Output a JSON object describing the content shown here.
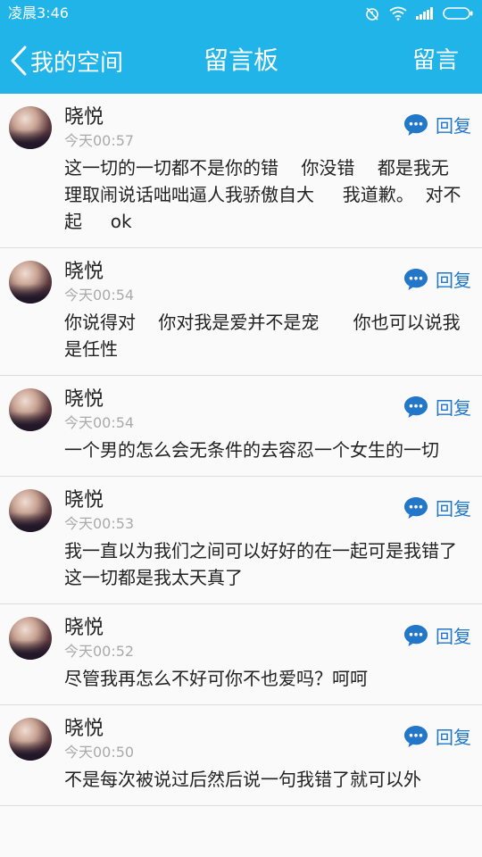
{
  "status_bar": {
    "time": "凌晨3:46"
  },
  "nav": {
    "back_label": "我的空间",
    "title": "留言板",
    "action_label": "留言"
  },
  "colors": {
    "primary": "#21b4e8",
    "reply_blue": "#2277c9"
  },
  "messages": [
    {
      "name": "晓悦",
      "time": "今天00:57",
      "content": "这一切的一切都不是你的错    你没错    都是我无理取闹说话咄咄逼人我骄傲自大     我道歉。  对不起     ok",
      "reply_label": "回复"
    },
    {
      "name": "晓悦",
      "time": "今天00:54",
      "content": "你说得对    你对我是爱并不是宠      你也可以说我是任性",
      "reply_label": "回复"
    },
    {
      "name": "晓悦",
      "time": "今天00:54",
      "content": "一个男的怎么会无条件的去容忍一个女生的一切",
      "reply_label": "回复"
    },
    {
      "name": "晓悦",
      "time": "今天00:53",
      "content": "我一直以为我们之间可以好好的在一起可是我错了     这一切都是我太天真了",
      "reply_label": "回复"
    },
    {
      "name": "晓悦",
      "time": "今天00:52",
      "content": "尽管我再怎么不好可你不也爱吗？呵呵",
      "reply_label": "回复"
    },
    {
      "name": "晓悦",
      "time": "今天00:50",
      "content": "不是每次被说过后然后说一句我错了就可以外",
      "reply_label": "回复"
    }
  ]
}
